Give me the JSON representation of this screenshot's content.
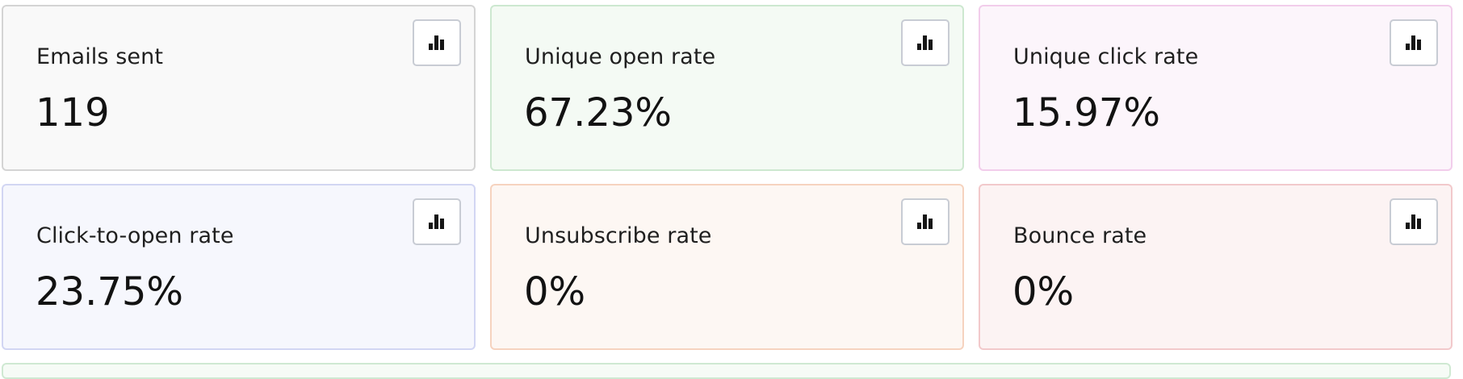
{
  "metrics": [
    {
      "label": "Emails sent",
      "value": "119",
      "bg": "#f9f9f9",
      "border": "#d4d4d4",
      "icon": "bar-chart-icon"
    },
    {
      "label": "Unique open rate",
      "value": "67.23%",
      "bg": "#f4faf4",
      "border": "#cde8d0",
      "icon": "bar-chart-icon"
    },
    {
      "label": "Unique click rate",
      "value": "15.97%",
      "bg": "#fcf5fb",
      "border": "#f2cdeb",
      "icon": "bar-chart-icon"
    },
    {
      "label": "Click-to-open rate",
      "value": "23.75%",
      "bg": "#f6f7fd",
      "border": "#d2d6f3",
      "icon": "bar-chart-icon"
    },
    {
      "label": "Unsubscribe rate",
      "value": "0%",
      "bg": "#fdf7f3",
      "border": "#f6d3bf",
      "icon": "bar-chart-icon"
    },
    {
      "label": "Bounce rate",
      "value": "0%",
      "bg": "#fcf3f3",
      "border": "#f2c9cb",
      "icon": "bar-chart-icon"
    }
  ],
  "bottom_strip": {
    "bg": "#f6fbf6",
    "border": "#cfe9d2"
  }
}
